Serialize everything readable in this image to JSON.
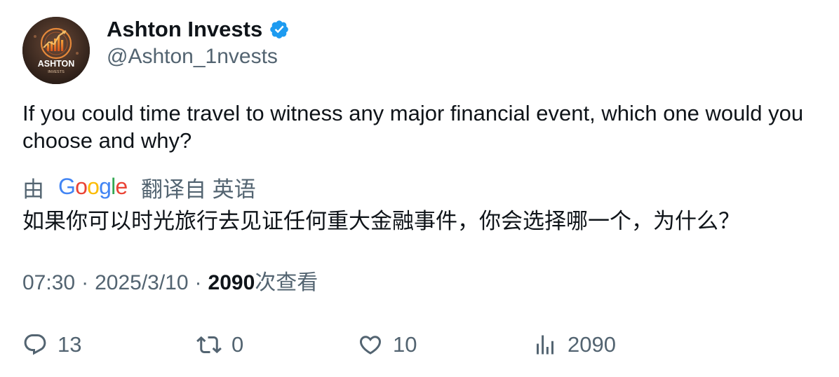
{
  "author": {
    "display_name": "Ashton Invests",
    "handle": "@Ashton_1nvests",
    "avatar_text": "ASHTON",
    "avatar_subtext": "INVESTS",
    "verified": true
  },
  "tweet": {
    "text": "If you could time travel to witness any major financial event, which one would you choose and why?"
  },
  "translation": {
    "prefix": "由",
    "provider": "Google",
    "suffix": "翻译自 英语",
    "text": "如果你可以时光旅行去见证任何重大金融事件，你会选择哪一个，为什么？"
  },
  "meta": {
    "time": "07:30",
    "separator": "·",
    "date": "2025/3/10",
    "views": "2090",
    "views_label": "次查看"
  },
  "actions": {
    "replies": "13",
    "retweets": "0",
    "likes": "10",
    "views": "2090"
  },
  "colors": {
    "text": "#0f1419",
    "secondary": "#536471",
    "verified": "#1d9bf0"
  },
  "icons": [
    "verified-badge-icon",
    "reply-icon",
    "retweet-icon",
    "like-icon",
    "views-icon",
    "google-logo"
  ]
}
